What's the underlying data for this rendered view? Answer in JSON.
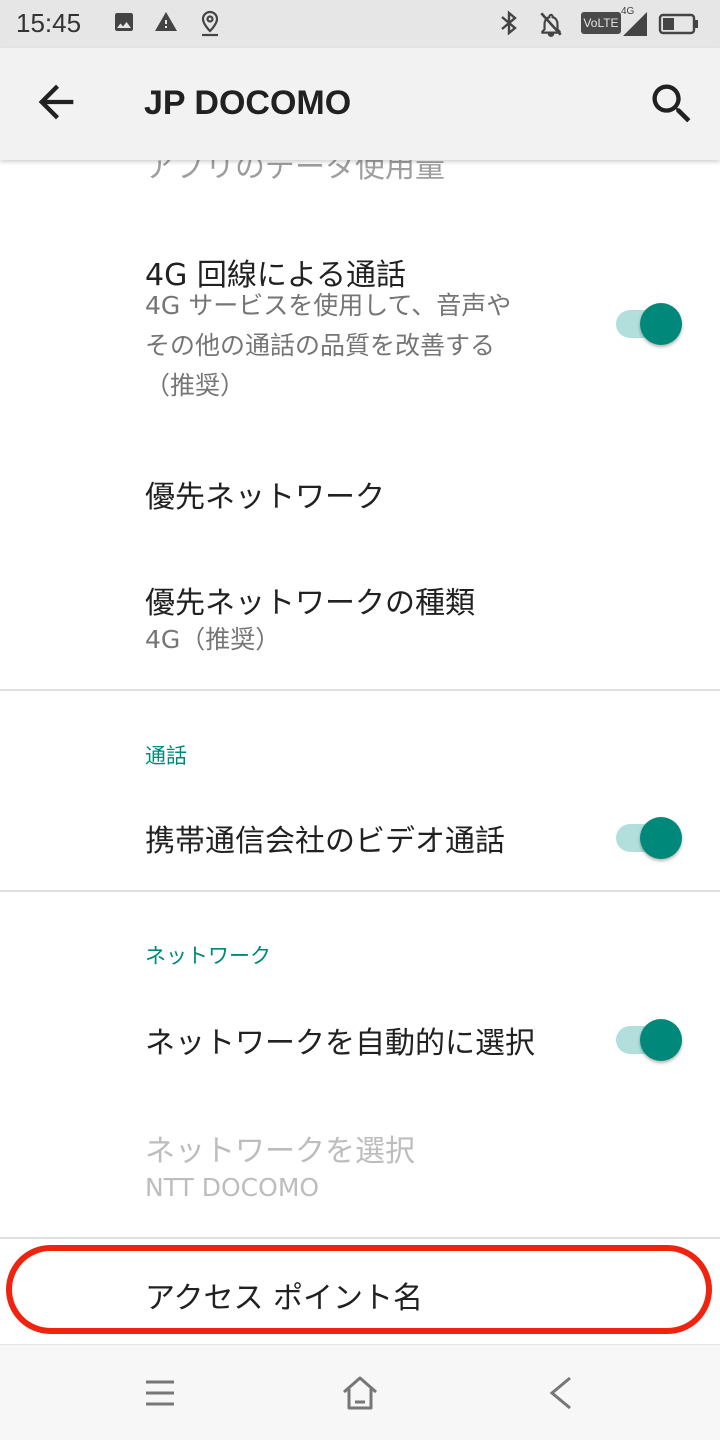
{
  "status_bar": {
    "time": "15:45",
    "left_icons": [
      "image-icon",
      "alert-icon",
      "location-icon"
    ],
    "right_icons": [
      "bluetooth-icon",
      "notifications-off-icon",
      "volte-icon",
      "signal-4g-icon",
      "battery-icon"
    ],
    "volte": "VoLTE",
    "network": "4G"
  },
  "app_bar": {
    "title": "JP DOCOMO",
    "back_icon": "arrow-back-icon",
    "search_icon": "search-icon"
  },
  "settings": {
    "partial_item": "アプリのデータ使用量",
    "vo4g": {
      "title": "4G 回線による通話",
      "summary_line1": "4G サービスを使用して、音声や",
      "summary_line2": "その他の通話の品質を改善する",
      "summary_line3": "（推奨）",
      "checked": true
    },
    "preferred_network": {
      "title": "優先ネットワーク"
    },
    "preferred_network_type": {
      "title": "優先ネットワークの種類",
      "summary": "4G（推奨）"
    },
    "calling_category": "通話",
    "video_calling": {
      "title": "携帯通信会社のビデオ通話",
      "checked": true
    },
    "network_category": "ネットワーク",
    "auto_select_network": {
      "title": "ネットワークを自動的に選択",
      "checked": true
    },
    "choose_network": {
      "title": "ネットワークを選択",
      "summary": "NTT DOCOMO",
      "enabled": false
    },
    "access_point_names": {
      "title": "アクセス ポイント名"
    }
  },
  "colors": {
    "accent": "#00897b",
    "switch_track": "#b2dfdb",
    "highlight": "#f0230f"
  },
  "nav_bar": {
    "icons": [
      "menu-icon",
      "home-icon",
      "back-icon"
    ]
  }
}
